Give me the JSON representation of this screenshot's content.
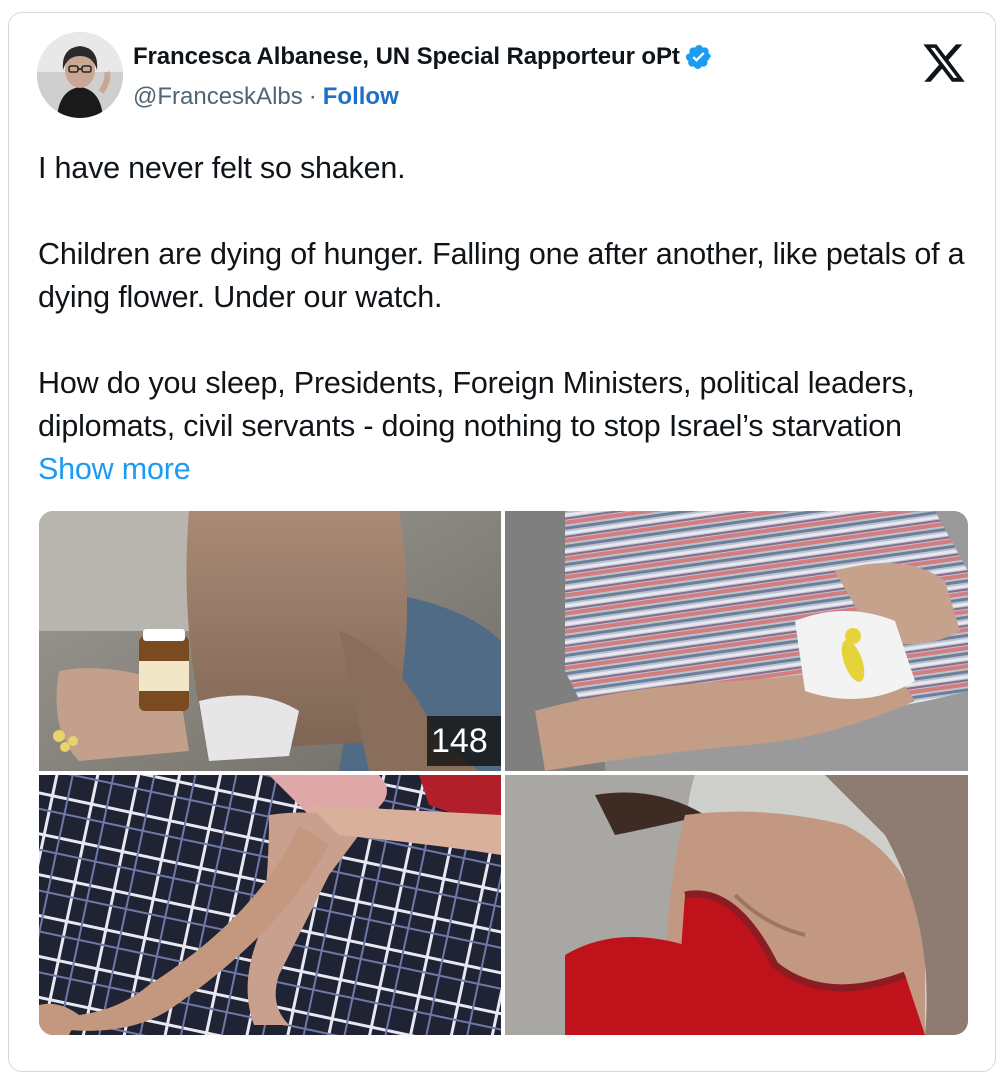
{
  "author": {
    "display_name": "Francesca Albanese, UN Special Rapporteur oPt",
    "handle": "@FranceskAlbs",
    "separator": "·",
    "follow_label": "Follow",
    "verified_icon": "verified-badge-icon",
    "avatar_icon": "profile-photo"
  },
  "brand": {
    "logo_icon": "x-logo-icon"
  },
  "tweet": {
    "paragraphs": [
      "I have never felt so shaken.",
      "Children are dying of hunger. Falling one after another, like petals of a dying flower. Under our watch.",
      "How do you sleep, Presidents, Foreign Ministers, political leaders, diplomats, civil servants - doing nothing to stop Israel’s starvation"
    ],
    "show_more_label": "Show more"
  },
  "media": {
    "overlay_counter": "148"
  },
  "colors": {
    "text_primary": "#0f1419",
    "text_secondary": "#536471",
    "link": "#1d9bf0",
    "follow": "#1d6fc9",
    "verified": "#1d9bf0",
    "card_border": "#cfd9de"
  }
}
